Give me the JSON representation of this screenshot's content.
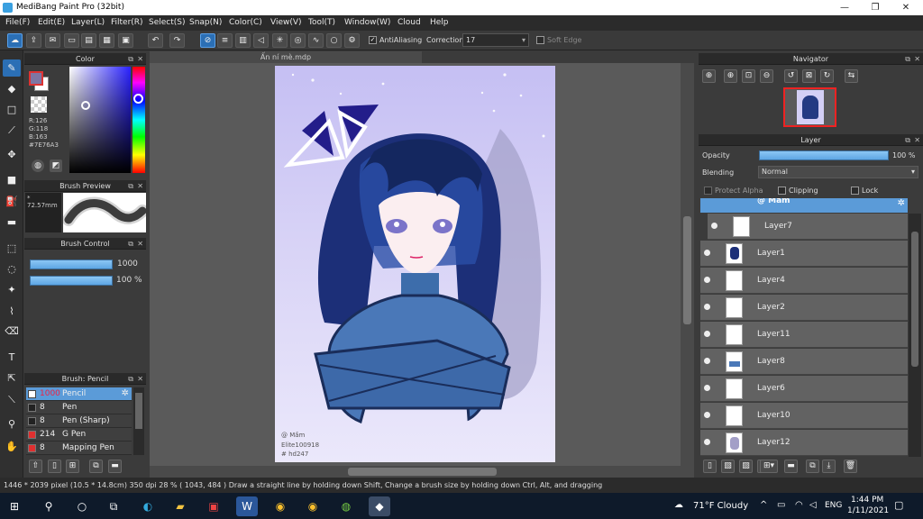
{
  "window": {
    "title": "MediBang Paint Pro (32bit)",
    "minimize": "—",
    "maximize": "❐",
    "close": "✕"
  },
  "menu": [
    "File(F)",
    "Edit(E)",
    "Layer(L)",
    "Filter(R)",
    "Select(S)",
    "Snap(N)",
    "Color(C)",
    "View(V)",
    "Tool(T)",
    "Window(W)",
    "Cloud",
    "Help"
  ],
  "toolbar": {
    "antialiasing": "AntiAliasing",
    "correction_label": "Correction",
    "correction_value": "17",
    "soft_edge": "Soft Edge"
  },
  "color_panel": {
    "title": "Color",
    "r": "R:126",
    "g": "G:118",
    "b": "B:163",
    "hex": "#7E76A3",
    "fg_color": "#7e76a3"
  },
  "brush_preview": {
    "title": "Brush Preview",
    "size": "* 72.57mm"
  },
  "brush_control": {
    "title": "Brush Control",
    "size_value": "1000",
    "opacity_value": "100 %"
  },
  "brush_list": {
    "title": "Brush: Pencil",
    "items": [
      {
        "num": "1000",
        "name": "Pencil",
        "color": "#ffffff",
        "selected": true
      },
      {
        "num": "8",
        "name": "Pen",
        "color": "#222222"
      },
      {
        "num": "8",
        "name": "Pen (Sharp)",
        "color": "#222222"
      },
      {
        "num": "214",
        "name": "G Pen",
        "color": "#e03030"
      },
      {
        "num": "8",
        "name": "Mapping Pen",
        "color": "#e03030"
      }
    ]
  },
  "document": {
    "tab": "Ấn ní mè.mdp",
    "signature": "@ Mầm",
    "sig2": "Elite100918",
    "sig3": "# hd247"
  },
  "navigator": {
    "title": "Navigator"
  },
  "layer_panel": {
    "title": "Layer",
    "opacity_label": "Opacity",
    "opacity_value": "100 %",
    "blending_label": "Blending",
    "blending_value": "Normal",
    "protect_alpha": "Protect Alpha",
    "clipping": "Clipping",
    "lock": "Lock",
    "folder": "@ Mầm",
    "layers": [
      "Layer7",
      "Layer1",
      "Layer4",
      "Layer2",
      "Layer11",
      "Layer8",
      "Layer6",
      "Layer10",
      "Layer12"
    ]
  },
  "status": {
    "text": "1446 * 2039 pixel  (10.5 * 14.8cm)  350 dpi  28 %  ( 1043, 484 )  Draw a straight line by holding down Shift, Change a brush size by holding down Ctrl, Alt, and dragging"
  },
  "taskbar": {
    "weather": "71°F  Cloudy",
    "lang": "ENG",
    "time": "1:44 PM",
    "date": "1/11/2021"
  }
}
